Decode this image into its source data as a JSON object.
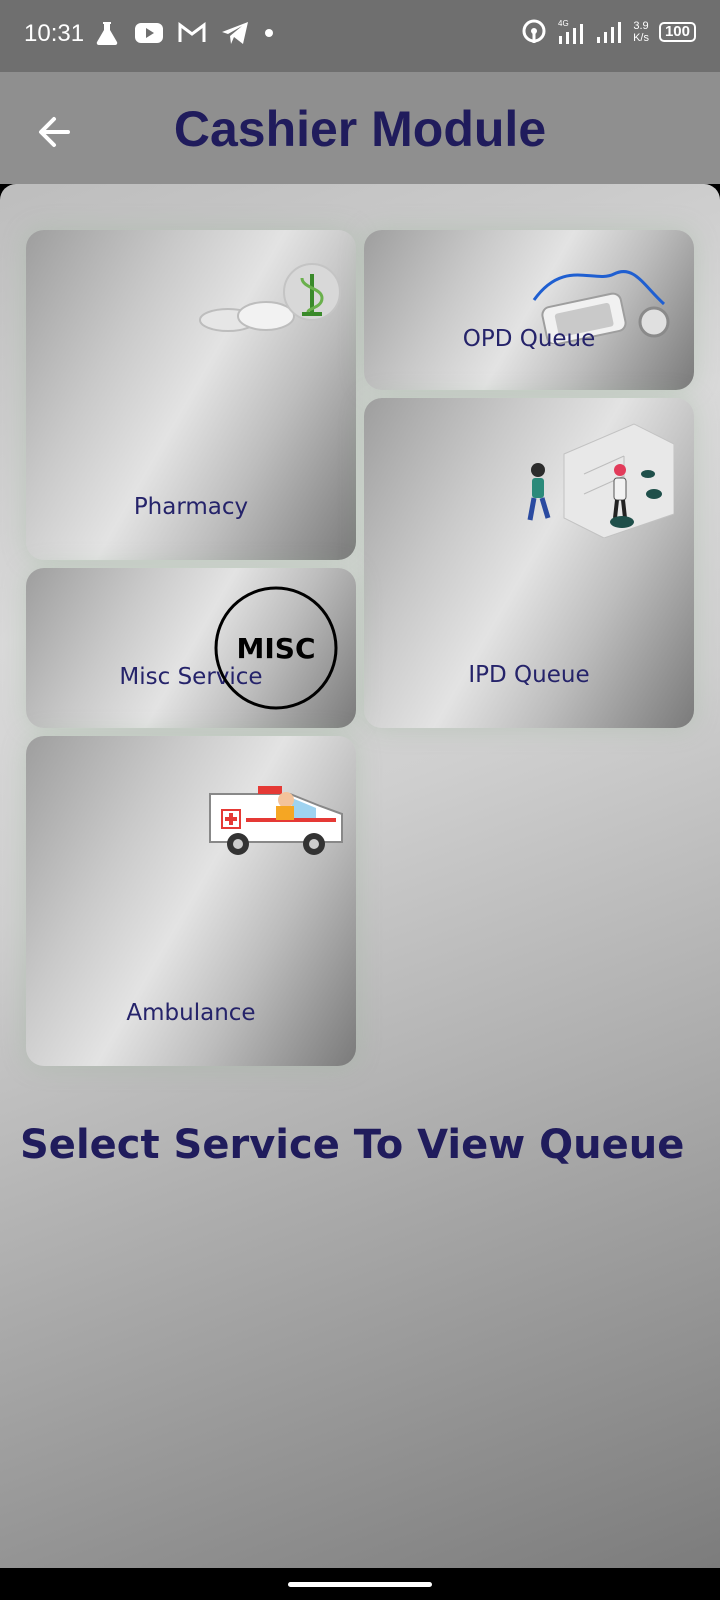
{
  "status_bar": {
    "time": "10:31",
    "net_speed_value": "3.9",
    "net_speed_unit": "K/s",
    "network_type": "4G",
    "battery": "100"
  },
  "app_bar": {
    "title": "Cashier Module",
    "back_icon": "arrow-left-icon"
  },
  "services": [
    {
      "label": "Pharmacy",
      "icon": "pharmacy-icon"
    },
    {
      "label": "OPD Queue",
      "icon": "stethoscope-phone-icon"
    },
    {
      "label": "IPD Queue",
      "icon": "ipd-illustration-icon"
    },
    {
      "label": "Misc Service",
      "icon": "misc-circle-icon",
      "icon_text": "MISC"
    },
    {
      "label": "Ambulance",
      "icon": "ambulance-icon"
    }
  ],
  "footer": {
    "prompt": "Select Service To View Queue"
  },
  "colors": {
    "title": "#201c5c",
    "label": "#25236a",
    "status_bar": "#6f6f6f",
    "app_bar": "#8f8f8f"
  }
}
